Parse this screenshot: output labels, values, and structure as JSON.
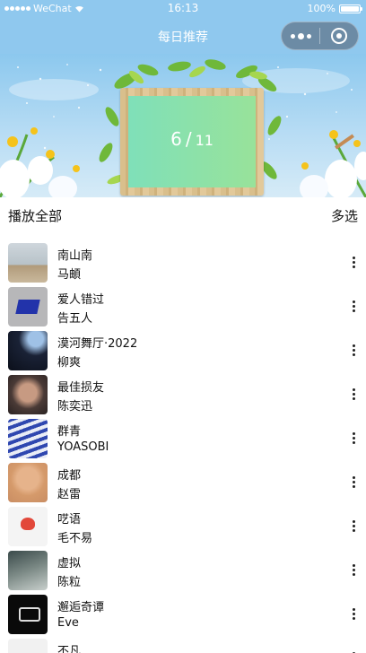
{
  "status_bar": {
    "carrier": "WeChat",
    "time": "16:13",
    "battery": "100%",
    "battery_level": 1.0
  },
  "nav": {
    "title": "每日推荐"
  },
  "banner": {
    "date_day": "6",
    "date_separator": "/",
    "date_month": "11"
  },
  "actions": {
    "play_all": "播放全部",
    "multi_select": "多选"
  },
  "songs": [
    {
      "name": "南山南",
      "artist": "马頔"
    },
    {
      "name": "爱人错过",
      "artist": "告五人"
    },
    {
      "name": "漠河舞厅·2022",
      "artist": "柳爽"
    },
    {
      "name": "最佳损友",
      "artist": "陈奕迅"
    },
    {
      "name": "群青",
      "artist": "YOASOBI"
    },
    {
      "name": "成都",
      "artist": "赵雷"
    },
    {
      "name": "呓语",
      "artist": "毛不易"
    },
    {
      "name": "虚拟",
      "artist": "陈粒"
    },
    {
      "name": "邂逅奇谭",
      "artist": "Eve"
    },
    {
      "name": "不凡",
      "artist": ""
    }
  ],
  "colors": {
    "nav_background": "#8fc8ee",
    "capsule": "#505a69",
    "date_board_green": "#8fe0aa"
  }
}
